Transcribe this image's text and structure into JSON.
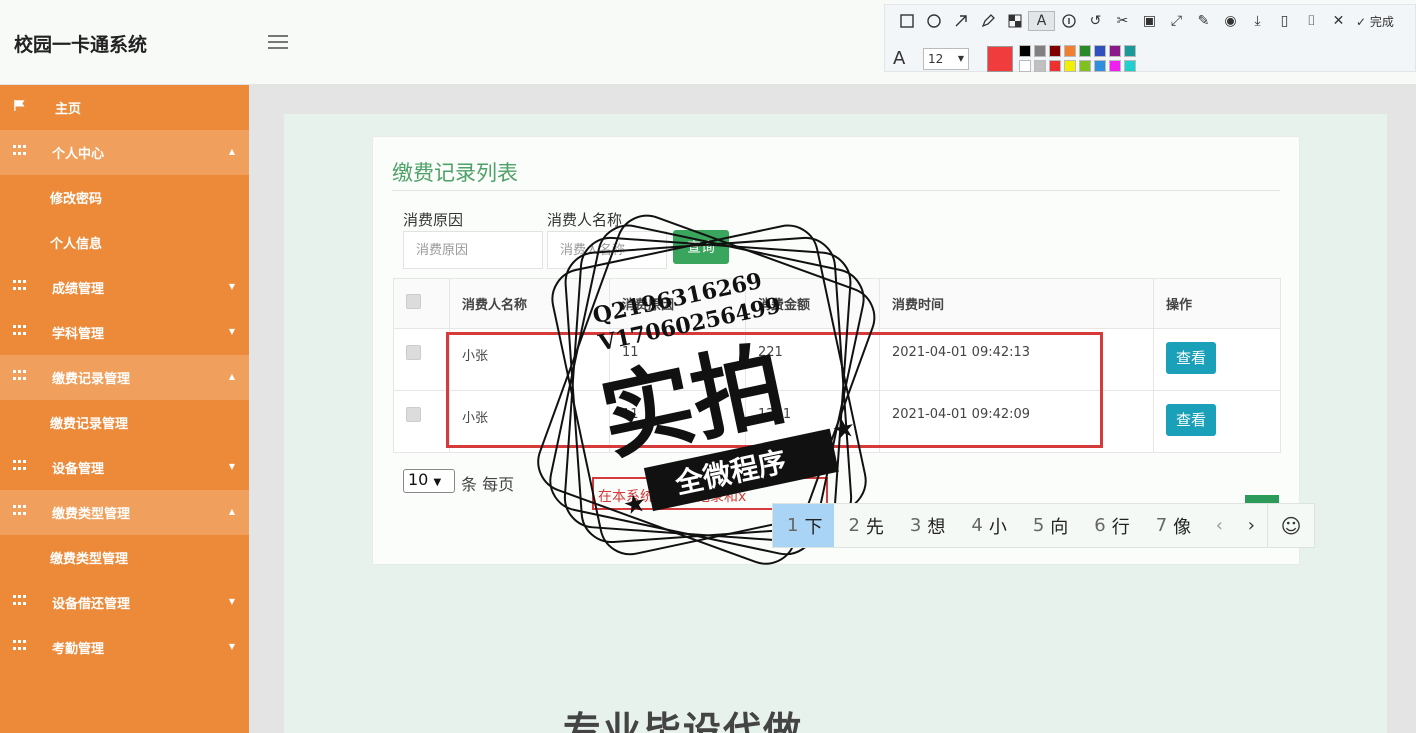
{
  "app": {
    "title": "校园一卡通系统"
  },
  "header": {
    "avatar_text": "80x80"
  },
  "sidebar": {
    "home": "主页",
    "groups": [
      {
        "label": "个人中心",
        "expanded": true,
        "children": [
          "修改密码",
          "个人信息"
        ]
      },
      {
        "label": "成绩管理",
        "expanded": false,
        "children": []
      },
      {
        "label": "学科管理",
        "expanded": false,
        "children": []
      },
      {
        "label": "缴费记录管理",
        "expanded": true,
        "children": [
          "缴费记录管理"
        ]
      },
      {
        "label": "设备管理",
        "expanded": false,
        "children": []
      },
      {
        "label": "缴费类型管理",
        "expanded": true,
        "children": [
          "缴费类型管理"
        ]
      },
      {
        "label": "设备借还管理",
        "expanded": false,
        "children": []
      },
      {
        "label": "考勤管理",
        "expanded": false,
        "children": []
      }
    ]
  },
  "main": {
    "title": "缴费记录列表",
    "search": {
      "reason_label": "消费原因",
      "reason_placeholder": "消费原因",
      "name_label": "消费人名称",
      "name_placeholder": "消费人名称",
      "query_button": "查询"
    },
    "table": {
      "headers": [
        "消费人名称",
        "消费原因",
        "消费金额",
        "消费时间",
        "操作"
      ],
      "rows": [
        {
          "name": "小张",
          "reason": "11",
          "amount": "221",
          "time": "2021-04-01 09:42:13",
          "action": "查看"
        },
        {
          "name": "小张",
          "reason": "11",
          "amount": "1221",
          "time": "2021-04-01 09:42:09",
          "action": "查看"
        }
      ]
    },
    "pagination": {
      "page_size": "10",
      "page_size_label": "条 每页"
    },
    "hint": "在本系统里充值记录和x"
  },
  "ime": {
    "candidates": [
      {
        "n": "1",
        "c": "下"
      },
      {
        "n": "2",
        "c": "先"
      },
      {
        "n": "3",
        "c": "想"
      },
      {
        "n": "4",
        "c": "小"
      },
      {
        "n": "5",
        "c": "向"
      },
      {
        "n": "6",
        "c": "行"
      },
      {
        "n": "7",
        "c": "像"
      }
    ],
    "prev": "‹",
    "next": "›",
    "emoji": "☺"
  },
  "annotation_toolbar": {
    "done_label": "完成",
    "font_size": "12",
    "current_color": "#f03c3c",
    "palette": [
      "#000000",
      "#808080",
      "#800000",
      "#f08030",
      "#2a8a2a",
      "#3050c0",
      "#8a1a8a",
      "#1a9a9a",
      "#ffffff",
      "#c0c0c0",
      "#f03030",
      "#f0f000",
      "#80c020",
      "#3090e0",
      "#f020f0",
      "#20d0d0"
    ]
  },
  "watermark": {
    "line1": "Q2196316269",
    "line2": "V17060256499",
    "main": "实拍",
    "ribbon": "全微程序",
    "bottom": "专业毕设代做"
  }
}
